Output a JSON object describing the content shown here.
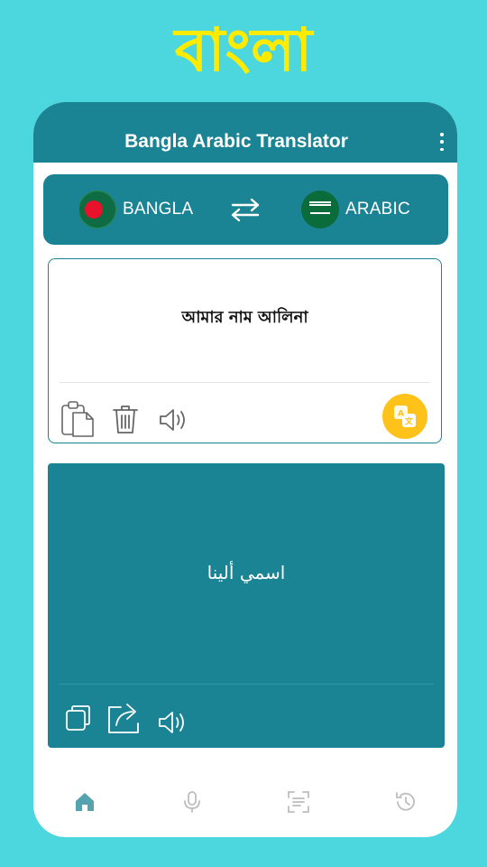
{
  "promo": {
    "title": "বাংলা"
  },
  "appbar": {
    "title": "Bangla Arabic Translator"
  },
  "languages": {
    "source": "BANGLA",
    "target": "ARABIC"
  },
  "input": {
    "text": "আমার নাম আলিনা"
  },
  "output": {
    "text": "اسمي ألينا"
  },
  "colors": {
    "background": "#4cd7df",
    "primary": "#1b8494",
    "accent": "#ffc21a",
    "promo_text": "#ffeb00"
  },
  "icons": {
    "input_tools": [
      "paste-icon",
      "delete-icon",
      "speaker-icon"
    ],
    "translate": "translate-icon",
    "output_tools": [
      "copy-icon",
      "share-icon",
      "speaker-icon"
    ],
    "bottom_nav": [
      "home-icon",
      "mic-icon",
      "scan-icon",
      "history-icon"
    ]
  }
}
